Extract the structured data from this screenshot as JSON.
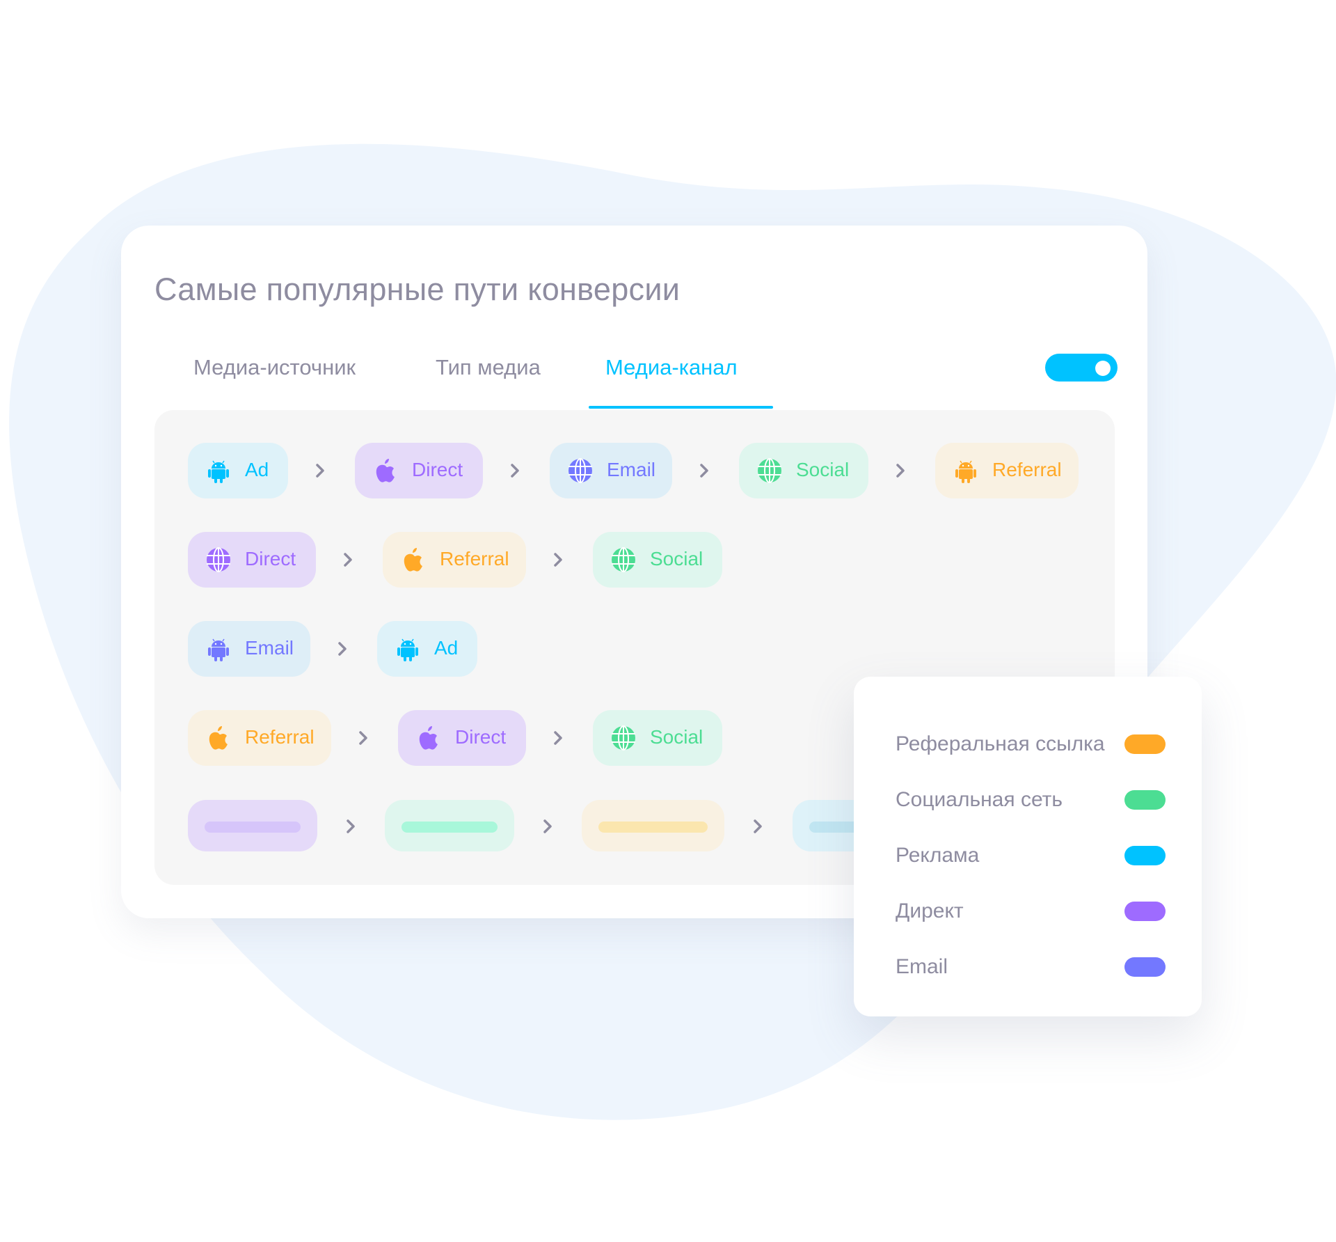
{
  "card": {
    "title": "Самые популярные пути конверсии",
    "tabs": [
      {
        "label": "Медиа-источник",
        "active": false
      },
      {
        "label": "Тип медиа",
        "active": false
      },
      {
        "label": "Медиа-канал",
        "active": true
      }
    ],
    "toggle": {
      "on": true
    }
  },
  "colors": {
    "accent": "#00C2FF",
    "referral": "#FFA927",
    "social": "#4CDD93",
    "ad": "#00C2FF",
    "direct": "#9E6BFF",
    "email": "#7378FF"
  },
  "paths": [
    [
      {
        "label": "Ad",
        "icon": "android-icon",
        "type": "ad"
      },
      {
        "label": "Direct",
        "icon": "apple-icon",
        "type": "direct"
      },
      {
        "label": "Email",
        "icon": "globe-icon",
        "type": "email"
      },
      {
        "label": "Social",
        "icon": "globe-icon",
        "type": "social"
      },
      {
        "label": "Referral",
        "icon": "android-icon",
        "type": "referral"
      }
    ],
    [
      {
        "label": "Direct",
        "icon": "globe-icon",
        "type": "direct"
      },
      {
        "label": "Referral",
        "icon": "apple-icon",
        "type": "referral"
      },
      {
        "label": "Social",
        "icon": "globe-icon",
        "type": "social"
      }
    ],
    [
      {
        "label": "Email",
        "icon": "android-icon",
        "type": "email"
      },
      {
        "label": "Ad",
        "icon": "android-icon",
        "type": "ad"
      }
    ],
    [
      {
        "label": "Referral",
        "icon": "apple-icon",
        "type": "referral"
      },
      {
        "label": "Direct",
        "icon": "apple-icon",
        "type": "direct"
      },
      {
        "label": "Social",
        "icon": "globe-icon",
        "type": "social"
      }
    ]
  ],
  "placeholder_path": [
    "direct",
    "social",
    "referral",
    "ad"
  ],
  "legend": [
    {
      "label": "Реферальная ссылка",
      "type": "referral"
    },
    {
      "label": "Социальная сеть",
      "type": "social"
    },
    {
      "label": "Реклама",
      "type": "ad"
    },
    {
      "label": "Директ",
      "type": "direct"
    },
    {
      "label": "Email",
      "type": "email"
    }
  ]
}
